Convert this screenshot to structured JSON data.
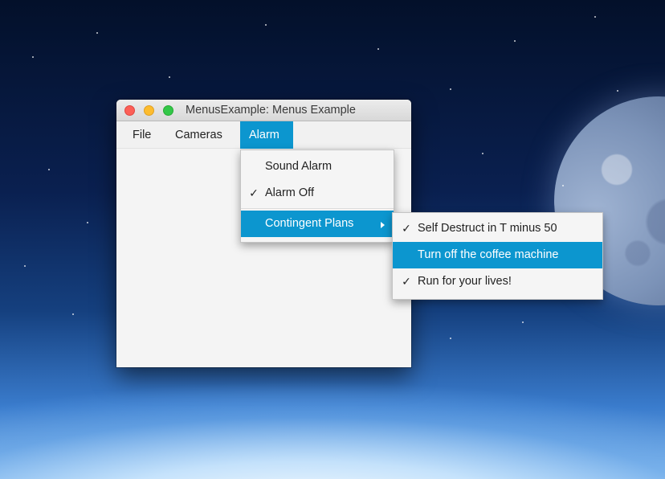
{
  "window": {
    "title": "MenusExample: Menus Example"
  },
  "menubar": {
    "file": "File",
    "cameras": "Cameras",
    "alarm": "Alarm"
  },
  "alarm_menu": {
    "sound_alarm": "Sound Alarm",
    "alarm_off": "Alarm Off",
    "alarm_off_checked": true,
    "contingent_plans": "Contingent Plans"
  },
  "contingent_submenu": {
    "items": [
      {
        "label": "Self Destruct in T minus 50",
        "checked": true
      },
      {
        "label": "Turn off the coffee machine",
        "checked": false,
        "highlighted": true
      },
      {
        "label": "Run for your lives!",
        "checked": true
      }
    ]
  },
  "glyphs": {
    "check": "✓"
  },
  "colors": {
    "accent": "#0c96cf",
    "close": "#fc5f57",
    "minimize": "#fdbc2e",
    "maximize": "#33c748"
  }
}
